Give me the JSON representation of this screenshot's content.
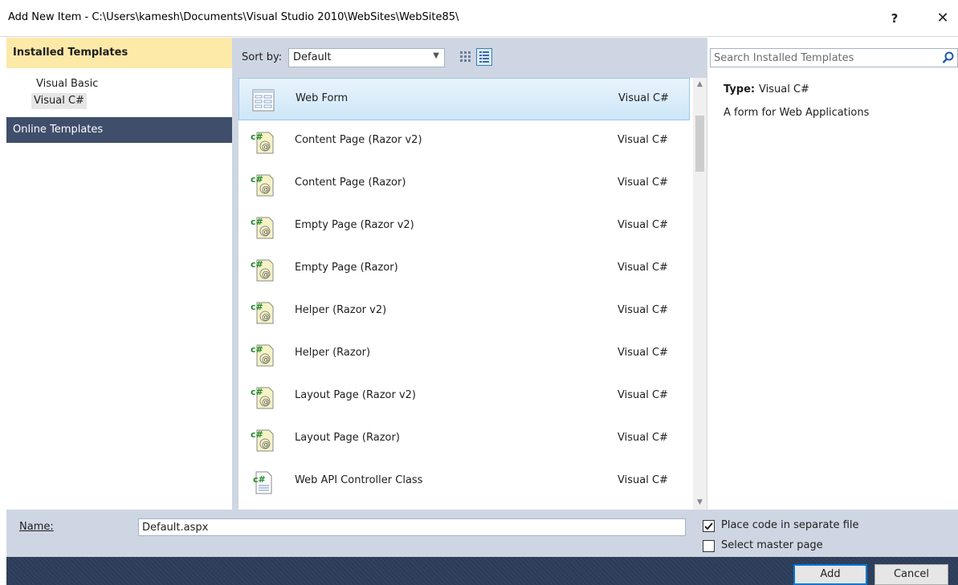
{
  "window": {
    "title": "Add New Item - C:\\Users\\kamesh\\Documents\\Visual Studio 2010\\WebSites\\WebSite85\\",
    "help_label": "?",
    "close_label": "✕"
  },
  "left": {
    "installed_header": "Installed Templates",
    "items": [
      {
        "label": "Visual Basic"
      },
      {
        "label": "Visual C#"
      }
    ],
    "online_label": "Online Templates"
  },
  "toolbar": {
    "sort_label": "Sort by:",
    "sort_value": "Default"
  },
  "templates": [
    {
      "name": "Web Form",
      "lang": "Visual C#",
      "icon": "webform-icon"
    },
    {
      "name": "Content Page (Razor v2)",
      "lang": "Visual C#",
      "icon": "csharp-razor-icon"
    },
    {
      "name": "Content Page (Razor)",
      "lang": "Visual C#",
      "icon": "csharp-razor-icon"
    },
    {
      "name": "Empty Page (Razor v2)",
      "lang": "Visual C#",
      "icon": "csharp-razor-icon"
    },
    {
      "name": "Empty Page (Razor)",
      "lang": "Visual C#",
      "icon": "csharp-razor-icon"
    },
    {
      "name": "Helper (Razor v2)",
      "lang": "Visual C#",
      "icon": "csharp-razor-icon"
    },
    {
      "name": "Helper (Razor)",
      "lang": "Visual C#",
      "icon": "csharp-razor-icon"
    },
    {
      "name": "Layout Page (Razor v2)",
      "lang": "Visual C#",
      "icon": "csharp-razor-icon"
    },
    {
      "name": "Layout Page (Razor)",
      "lang": "Visual C#",
      "icon": "csharp-razor-icon"
    },
    {
      "name": "Web API Controller Class",
      "lang": "Visual C#",
      "icon": "csharp-class-icon"
    }
  ],
  "details": {
    "search_placeholder": "Search Installed Templates",
    "type_label": "Type:",
    "type_value": "Visual C#",
    "description": "A form for Web Applications"
  },
  "form": {
    "name_label": "Name:",
    "name_value": "Default.aspx",
    "place_code_label": "Place code in separate file",
    "place_code_checked": true,
    "master_page_label": "Select master page",
    "master_page_checked": false
  },
  "buttons": {
    "add": "Add",
    "cancel": "Cancel"
  },
  "colors": {
    "left_header": "#fde9a8",
    "online_bg": "#3f4f6b",
    "panel_bg": "#ced6e3",
    "footer_bg": "#2b3c59",
    "accent": "#0078d7"
  }
}
